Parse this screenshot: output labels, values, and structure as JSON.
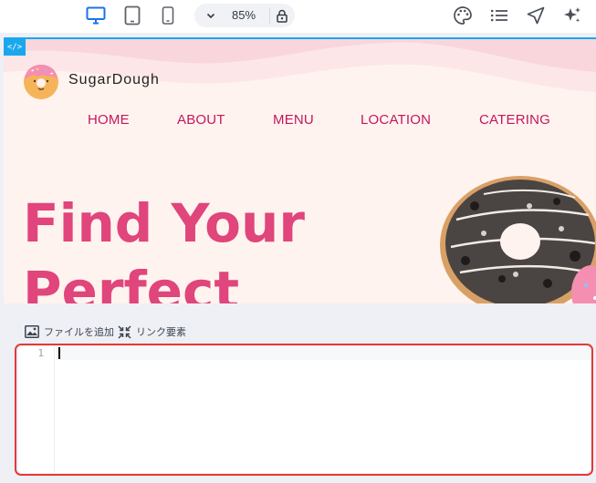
{
  "toolbar": {
    "devices": [
      {
        "icon": "desktop-icon",
        "active": true
      },
      {
        "icon": "tablet-icon",
        "active": false
      },
      {
        "icon": "mobile-icon",
        "active": false
      }
    ],
    "zoom": "85%",
    "right_icons": [
      "palette-icon",
      "list-icon",
      "send-icon",
      "sparkle-icon"
    ],
    "accent_color": "#1a73e8"
  },
  "preview": {
    "code_tag": "</>",
    "brand": "SugarDough",
    "nav": [
      "HOME",
      "ABOUT",
      "MENU",
      "LOCATION",
      "CATERING"
    ],
    "hero_line1": "Find Your",
    "hero_line2": "Perfect",
    "colors": {
      "nav": "#c2185b",
      "hero": "#e0457b",
      "background": "#fff3ef",
      "frame_border": "#1aa7ee"
    }
  },
  "editor": {
    "actions": [
      {
        "icon": "image-icon",
        "label": "ファイルを追加"
      },
      {
        "icon": "link-elements-icon",
        "label": "リンク要素"
      }
    ],
    "line_numbers": [
      "1"
    ],
    "content": "",
    "highlight_color": "#e53935"
  }
}
